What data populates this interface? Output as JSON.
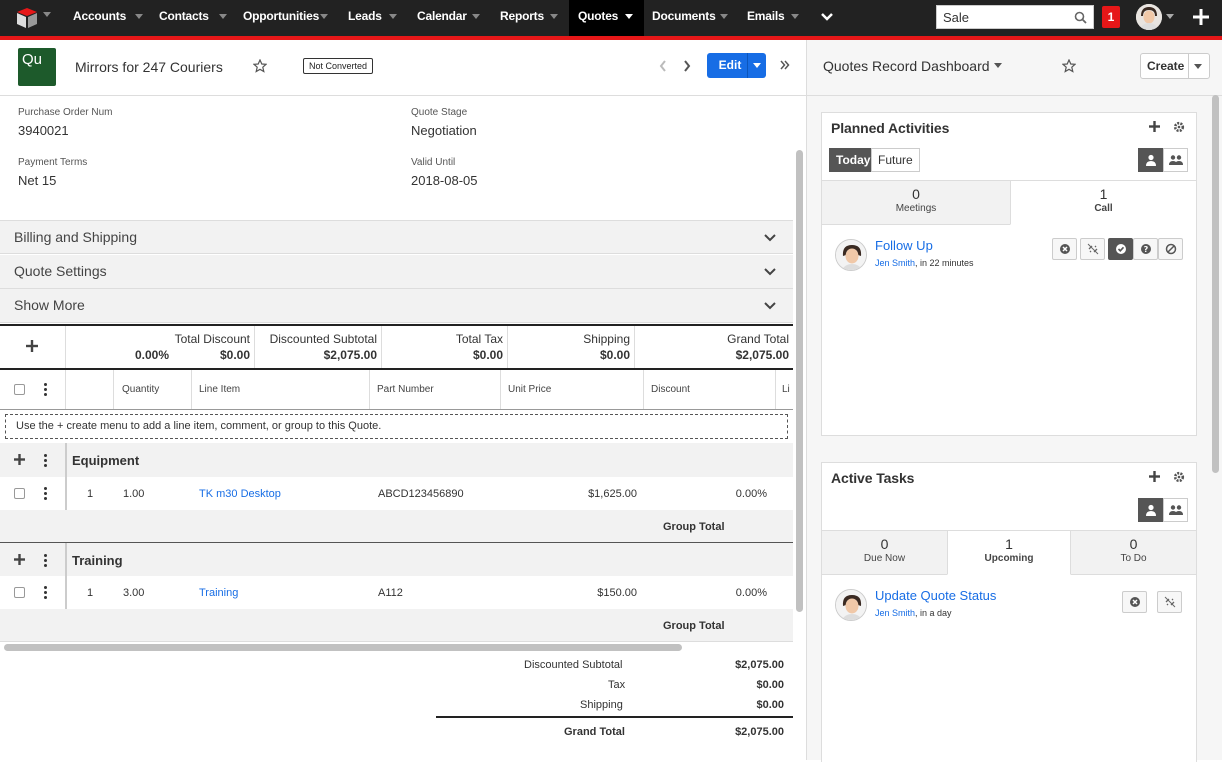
{
  "nav": {
    "tabs": [
      {
        "label": "Accounts",
        "active": false
      },
      {
        "label": "Contacts",
        "active": false
      },
      {
        "label": "Opportunities",
        "active": false
      },
      {
        "label": "Leads",
        "active": false
      },
      {
        "label": "Calendar",
        "active": false
      },
      {
        "label": "Reports",
        "active": false
      },
      {
        "label": "Quotes",
        "active": true
      },
      {
        "label": "Documents",
        "active": false
      },
      {
        "label": "Emails",
        "active": false
      }
    ],
    "more_icon": "chevron-down-icon",
    "search_value": "Sale",
    "search_icon": "search-icon",
    "notification_count": "1",
    "accent_color": "#e61718"
  },
  "record": {
    "module_badge": "Qu",
    "title": "Mirrors for 247 Couriers",
    "status_tag": "Not Converted",
    "edit_label": "Edit",
    "fields": {
      "po_label": "Purchase Order Num",
      "po_value": "3940021",
      "stage_label": "Quote Stage",
      "stage_value": "Negotiation",
      "terms_label": "Payment Terms",
      "terms_value": "Net 15",
      "valid_label": "Valid Until",
      "valid_value": "2018-08-05"
    },
    "panels": [
      "Billing and Shipping",
      "Quote Settings",
      "Show More"
    ]
  },
  "totals": {
    "discount_label": "Total Discount",
    "discount_pct": "0.00%",
    "discount_value": "$0.00",
    "subtotal_label": "Discounted Subtotal",
    "subtotal_value": "$2,075.00",
    "tax_label": "Total Tax",
    "tax_value": "$0.00",
    "shipping_label": "Shipping",
    "shipping_value": "$0.00",
    "grand_label": "Grand Total",
    "grand_value": "$2,075.00"
  },
  "columns": {
    "quantity": "Quantity",
    "line_item": "Line Item",
    "part_number": "Part Number",
    "unit_price": "Unit Price",
    "discount": "Discount",
    "overflow": "Li"
  },
  "hint": "Use the + create menu to add a line item, comment, or group to this Quote.",
  "groups": [
    {
      "name": "Equipment",
      "line": {
        "index": "1",
        "qty": "1.00",
        "item": "TK m30 Desktop",
        "part": "ABCD123456890",
        "price": "$1,625.00",
        "discount": "0.00%"
      },
      "total_label": "Group Total"
    },
    {
      "name": "Training",
      "line": {
        "index": "1",
        "qty": "3.00",
        "item": "Training",
        "part": "A112",
        "price": "$150.00",
        "discount": "0.00%"
      },
      "total_label": "Group Total"
    }
  ],
  "summary": {
    "subtotal_label": "Discounted Subtotal",
    "subtotal_value": "$2,075.00",
    "tax_label": "Tax",
    "tax_value": "$0.00",
    "shipping_label": "Shipping",
    "shipping_value": "$0.00",
    "grand_label": "Grand Total",
    "grand_value": "$2,075.00"
  },
  "dashboard": {
    "title": "Quotes Record Dashboard",
    "create_label": "Create",
    "planned": {
      "title": "Planned Activities",
      "today_label": "Today",
      "future_label": "Future",
      "meetings_count": "0",
      "meetings_label": "Meetings",
      "calls_count": "1",
      "calls_label": "Call",
      "activity": {
        "title": "Follow Up",
        "user": "Jen Smith",
        "when": ", in 22 minutes"
      }
    },
    "tasks": {
      "title": "Active Tasks",
      "due_count": "0",
      "due_label": "Due Now",
      "upcoming_count": "1",
      "upcoming_label": "Upcoming",
      "todo_count": "0",
      "todo_label": "To Do",
      "task": {
        "title": "Update Quote Status",
        "user": "Jen Smith",
        "when": ", in a day"
      }
    }
  }
}
